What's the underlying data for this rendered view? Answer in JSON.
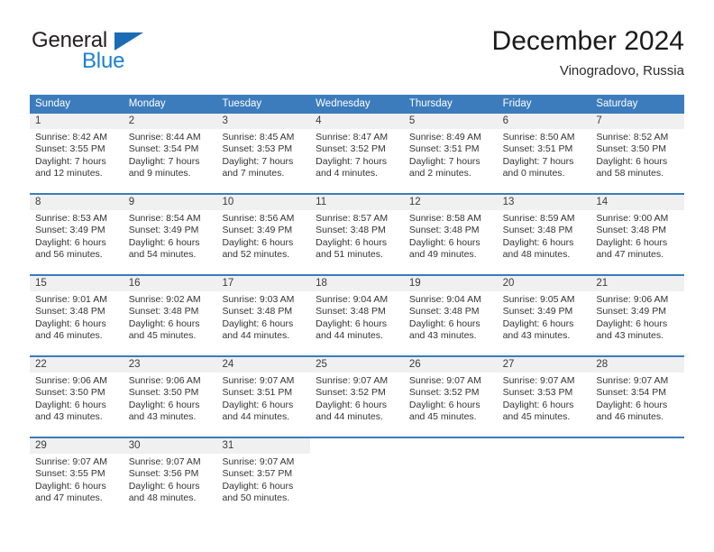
{
  "brand": {
    "name_dark": "General",
    "name_light": "Blue",
    "triangle_color": "#1b6cb5",
    "light_color": "#1b7fd4"
  },
  "header": {
    "title": "December 2024",
    "subtitle": "Vinogradovo, Russia"
  },
  "theme": {
    "header_bg": "#3c7cbd",
    "daynum_bg": "#f0f0f0",
    "text": "#333333"
  },
  "weekdays": [
    "Sunday",
    "Monday",
    "Tuesday",
    "Wednesday",
    "Thursday",
    "Friday",
    "Saturday"
  ],
  "weeks": [
    [
      {
        "day": "1",
        "sunrise": "Sunrise: 8:42 AM",
        "sunset": "Sunset: 3:55 PM",
        "daylight1": "Daylight: 7 hours",
        "daylight2": "and 12 minutes."
      },
      {
        "day": "2",
        "sunrise": "Sunrise: 8:44 AM",
        "sunset": "Sunset: 3:54 PM",
        "daylight1": "Daylight: 7 hours",
        "daylight2": "and 9 minutes."
      },
      {
        "day": "3",
        "sunrise": "Sunrise: 8:45 AM",
        "sunset": "Sunset: 3:53 PM",
        "daylight1": "Daylight: 7 hours",
        "daylight2": "and 7 minutes."
      },
      {
        "day": "4",
        "sunrise": "Sunrise: 8:47 AM",
        "sunset": "Sunset: 3:52 PM",
        "daylight1": "Daylight: 7 hours",
        "daylight2": "and 4 minutes."
      },
      {
        "day": "5",
        "sunrise": "Sunrise: 8:49 AM",
        "sunset": "Sunset: 3:51 PM",
        "daylight1": "Daylight: 7 hours",
        "daylight2": "and 2 minutes."
      },
      {
        "day": "6",
        "sunrise": "Sunrise: 8:50 AM",
        "sunset": "Sunset: 3:51 PM",
        "daylight1": "Daylight: 7 hours",
        "daylight2": "and 0 minutes."
      },
      {
        "day": "7",
        "sunrise": "Sunrise: 8:52 AM",
        "sunset": "Sunset: 3:50 PM",
        "daylight1": "Daylight: 6 hours",
        "daylight2": "and 58 minutes."
      }
    ],
    [
      {
        "day": "8",
        "sunrise": "Sunrise: 8:53 AM",
        "sunset": "Sunset: 3:49 PM",
        "daylight1": "Daylight: 6 hours",
        "daylight2": "and 56 minutes."
      },
      {
        "day": "9",
        "sunrise": "Sunrise: 8:54 AM",
        "sunset": "Sunset: 3:49 PM",
        "daylight1": "Daylight: 6 hours",
        "daylight2": "and 54 minutes."
      },
      {
        "day": "10",
        "sunrise": "Sunrise: 8:56 AM",
        "sunset": "Sunset: 3:49 PM",
        "daylight1": "Daylight: 6 hours",
        "daylight2": "and 52 minutes."
      },
      {
        "day": "11",
        "sunrise": "Sunrise: 8:57 AM",
        "sunset": "Sunset: 3:48 PM",
        "daylight1": "Daylight: 6 hours",
        "daylight2": "and 51 minutes."
      },
      {
        "day": "12",
        "sunrise": "Sunrise: 8:58 AM",
        "sunset": "Sunset: 3:48 PM",
        "daylight1": "Daylight: 6 hours",
        "daylight2": "and 49 minutes."
      },
      {
        "day": "13",
        "sunrise": "Sunrise: 8:59 AM",
        "sunset": "Sunset: 3:48 PM",
        "daylight1": "Daylight: 6 hours",
        "daylight2": "and 48 minutes."
      },
      {
        "day": "14",
        "sunrise": "Sunrise: 9:00 AM",
        "sunset": "Sunset: 3:48 PM",
        "daylight1": "Daylight: 6 hours",
        "daylight2": "and 47 minutes."
      }
    ],
    [
      {
        "day": "15",
        "sunrise": "Sunrise: 9:01 AM",
        "sunset": "Sunset: 3:48 PM",
        "daylight1": "Daylight: 6 hours",
        "daylight2": "and 46 minutes."
      },
      {
        "day": "16",
        "sunrise": "Sunrise: 9:02 AM",
        "sunset": "Sunset: 3:48 PM",
        "daylight1": "Daylight: 6 hours",
        "daylight2": "and 45 minutes."
      },
      {
        "day": "17",
        "sunrise": "Sunrise: 9:03 AM",
        "sunset": "Sunset: 3:48 PM",
        "daylight1": "Daylight: 6 hours",
        "daylight2": "and 44 minutes."
      },
      {
        "day": "18",
        "sunrise": "Sunrise: 9:04 AM",
        "sunset": "Sunset: 3:48 PM",
        "daylight1": "Daylight: 6 hours",
        "daylight2": "and 44 minutes."
      },
      {
        "day": "19",
        "sunrise": "Sunrise: 9:04 AM",
        "sunset": "Sunset: 3:48 PM",
        "daylight1": "Daylight: 6 hours",
        "daylight2": "and 43 minutes."
      },
      {
        "day": "20",
        "sunrise": "Sunrise: 9:05 AM",
        "sunset": "Sunset: 3:49 PM",
        "daylight1": "Daylight: 6 hours",
        "daylight2": "and 43 minutes."
      },
      {
        "day": "21",
        "sunrise": "Sunrise: 9:06 AM",
        "sunset": "Sunset: 3:49 PM",
        "daylight1": "Daylight: 6 hours",
        "daylight2": "and 43 minutes."
      }
    ],
    [
      {
        "day": "22",
        "sunrise": "Sunrise: 9:06 AM",
        "sunset": "Sunset: 3:50 PM",
        "daylight1": "Daylight: 6 hours",
        "daylight2": "and 43 minutes."
      },
      {
        "day": "23",
        "sunrise": "Sunrise: 9:06 AM",
        "sunset": "Sunset: 3:50 PM",
        "daylight1": "Daylight: 6 hours",
        "daylight2": "and 43 minutes."
      },
      {
        "day": "24",
        "sunrise": "Sunrise: 9:07 AM",
        "sunset": "Sunset: 3:51 PM",
        "daylight1": "Daylight: 6 hours",
        "daylight2": "and 44 minutes."
      },
      {
        "day": "25",
        "sunrise": "Sunrise: 9:07 AM",
        "sunset": "Sunset: 3:52 PM",
        "daylight1": "Daylight: 6 hours",
        "daylight2": "and 44 minutes."
      },
      {
        "day": "26",
        "sunrise": "Sunrise: 9:07 AM",
        "sunset": "Sunset: 3:52 PM",
        "daylight1": "Daylight: 6 hours",
        "daylight2": "and 45 minutes."
      },
      {
        "day": "27",
        "sunrise": "Sunrise: 9:07 AM",
        "sunset": "Sunset: 3:53 PM",
        "daylight1": "Daylight: 6 hours",
        "daylight2": "and 45 minutes."
      },
      {
        "day": "28",
        "sunrise": "Sunrise: 9:07 AM",
        "sunset": "Sunset: 3:54 PM",
        "daylight1": "Daylight: 6 hours",
        "daylight2": "and 46 minutes."
      }
    ],
    [
      {
        "day": "29",
        "sunrise": "Sunrise: 9:07 AM",
        "sunset": "Sunset: 3:55 PM",
        "daylight1": "Daylight: 6 hours",
        "daylight2": "and 47 minutes."
      },
      {
        "day": "30",
        "sunrise": "Sunrise: 9:07 AM",
        "sunset": "Sunset: 3:56 PM",
        "daylight1": "Daylight: 6 hours",
        "daylight2": "and 48 minutes."
      },
      {
        "day": "31",
        "sunrise": "Sunrise: 9:07 AM",
        "sunset": "Sunset: 3:57 PM",
        "daylight1": "Daylight: 6 hours",
        "daylight2": "and 50 minutes."
      },
      {
        "day": "",
        "sunrise": "",
        "sunset": "",
        "daylight1": "",
        "daylight2": ""
      },
      {
        "day": "",
        "sunrise": "",
        "sunset": "",
        "daylight1": "",
        "daylight2": ""
      },
      {
        "day": "",
        "sunrise": "",
        "sunset": "",
        "daylight1": "",
        "daylight2": ""
      },
      {
        "day": "",
        "sunrise": "",
        "sunset": "",
        "daylight1": "",
        "daylight2": ""
      }
    ]
  ]
}
